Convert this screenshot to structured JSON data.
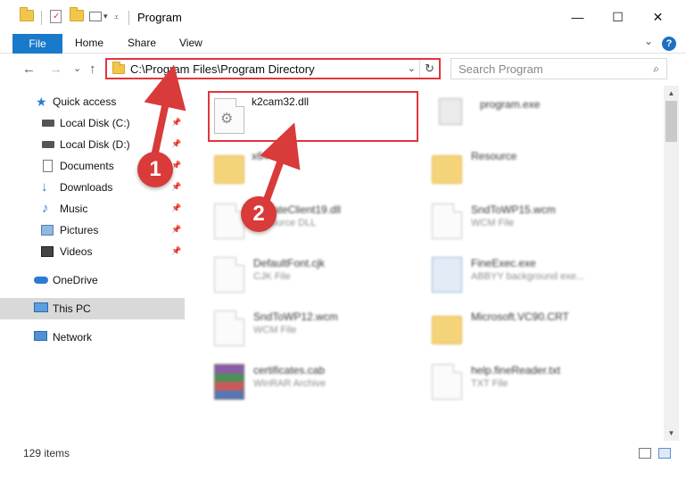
{
  "window": {
    "title": "Program",
    "minimize": "—",
    "maximize": "☐",
    "close": "✕"
  },
  "ribbon": {
    "tabs": [
      "File",
      "Home",
      "Share",
      "View"
    ],
    "expand": "⌄",
    "help": "?"
  },
  "nav": {
    "back": "←",
    "forward": "→",
    "recent": "⌄",
    "up": "↑",
    "address": "C:\\Program Files\\Program Directory",
    "address_dropdown": "⌄",
    "refresh": "↻",
    "search_placeholder": "Search Program",
    "search_icon": "⌕"
  },
  "sidebar": {
    "items": [
      {
        "label": "Quick access",
        "icon": "star-icon",
        "pinned": false
      },
      {
        "label": "Local Disk (C:)",
        "icon": "drive-icon",
        "pinned": true
      },
      {
        "label": "Local Disk (D:)",
        "icon": "drive-icon",
        "pinned": true
      },
      {
        "label": "Documents",
        "icon": "documents-icon",
        "pinned": true
      },
      {
        "label": "Downloads",
        "icon": "download-icon",
        "pinned": true
      },
      {
        "label": "Music",
        "icon": "music-icon",
        "pinned": true
      },
      {
        "label": "Pictures",
        "icon": "pictures-icon",
        "pinned": true
      },
      {
        "label": "Videos",
        "icon": "videos-icon",
        "pinned": true
      },
      {
        "label": "OneDrive",
        "icon": "cloud-icon",
        "pinned": false
      },
      {
        "label": "This PC",
        "icon": "pc-icon",
        "pinned": false,
        "selected": true
      },
      {
        "label": "Network",
        "icon": "network-icon",
        "pinned": false
      }
    ],
    "pin_glyph": "📌"
  },
  "files": [
    {
      "name": "k2cam32.dll",
      "type": "",
      "icon": "dll-icon",
      "highlighted": true
    },
    {
      "name": "program.exe",
      "type": "",
      "icon": "exe-icon"
    },
    {
      "name": "x64",
      "type": "",
      "icon": "folder-icon"
    },
    {
      "name": "Resource",
      "type": "",
      "icon": "folder-icon"
    },
    {
      "name": "UpdateClient19.dll",
      "type": "Resource DLL",
      "icon": "dll-icon"
    },
    {
      "name": "SndToWP15.wcm",
      "type": "WCM File",
      "icon": "file-icon"
    },
    {
      "name": "DefaultFont.cjk",
      "type": "CJK File",
      "icon": "file-icon"
    },
    {
      "name": "FineExec.exe",
      "type": "ABBYY background exe...",
      "icon": "exe-icon"
    },
    {
      "name": "SndToWP12.wcm",
      "type": "WCM File",
      "icon": "file-icon"
    },
    {
      "name": "Microsoft.VC90.CRT",
      "type": "",
      "icon": "folder-icon"
    },
    {
      "name": "certificates.cab",
      "type": "WinRAR Archive",
      "icon": "archive-icon"
    },
    {
      "name": "help.fineReader.txt",
      "type": "TXT File",
      "icon": "file-icon"
    }
  ],
  "status": {
    "count": "129 items"
  },
  "annotations": {
    "step1": "1",
    "step2": "2",
    "color": "#d93a3a"
  },
  "colors": {
    "file_tab": "#1979ca",
    "highlight": "#e0363e"
  }
}
